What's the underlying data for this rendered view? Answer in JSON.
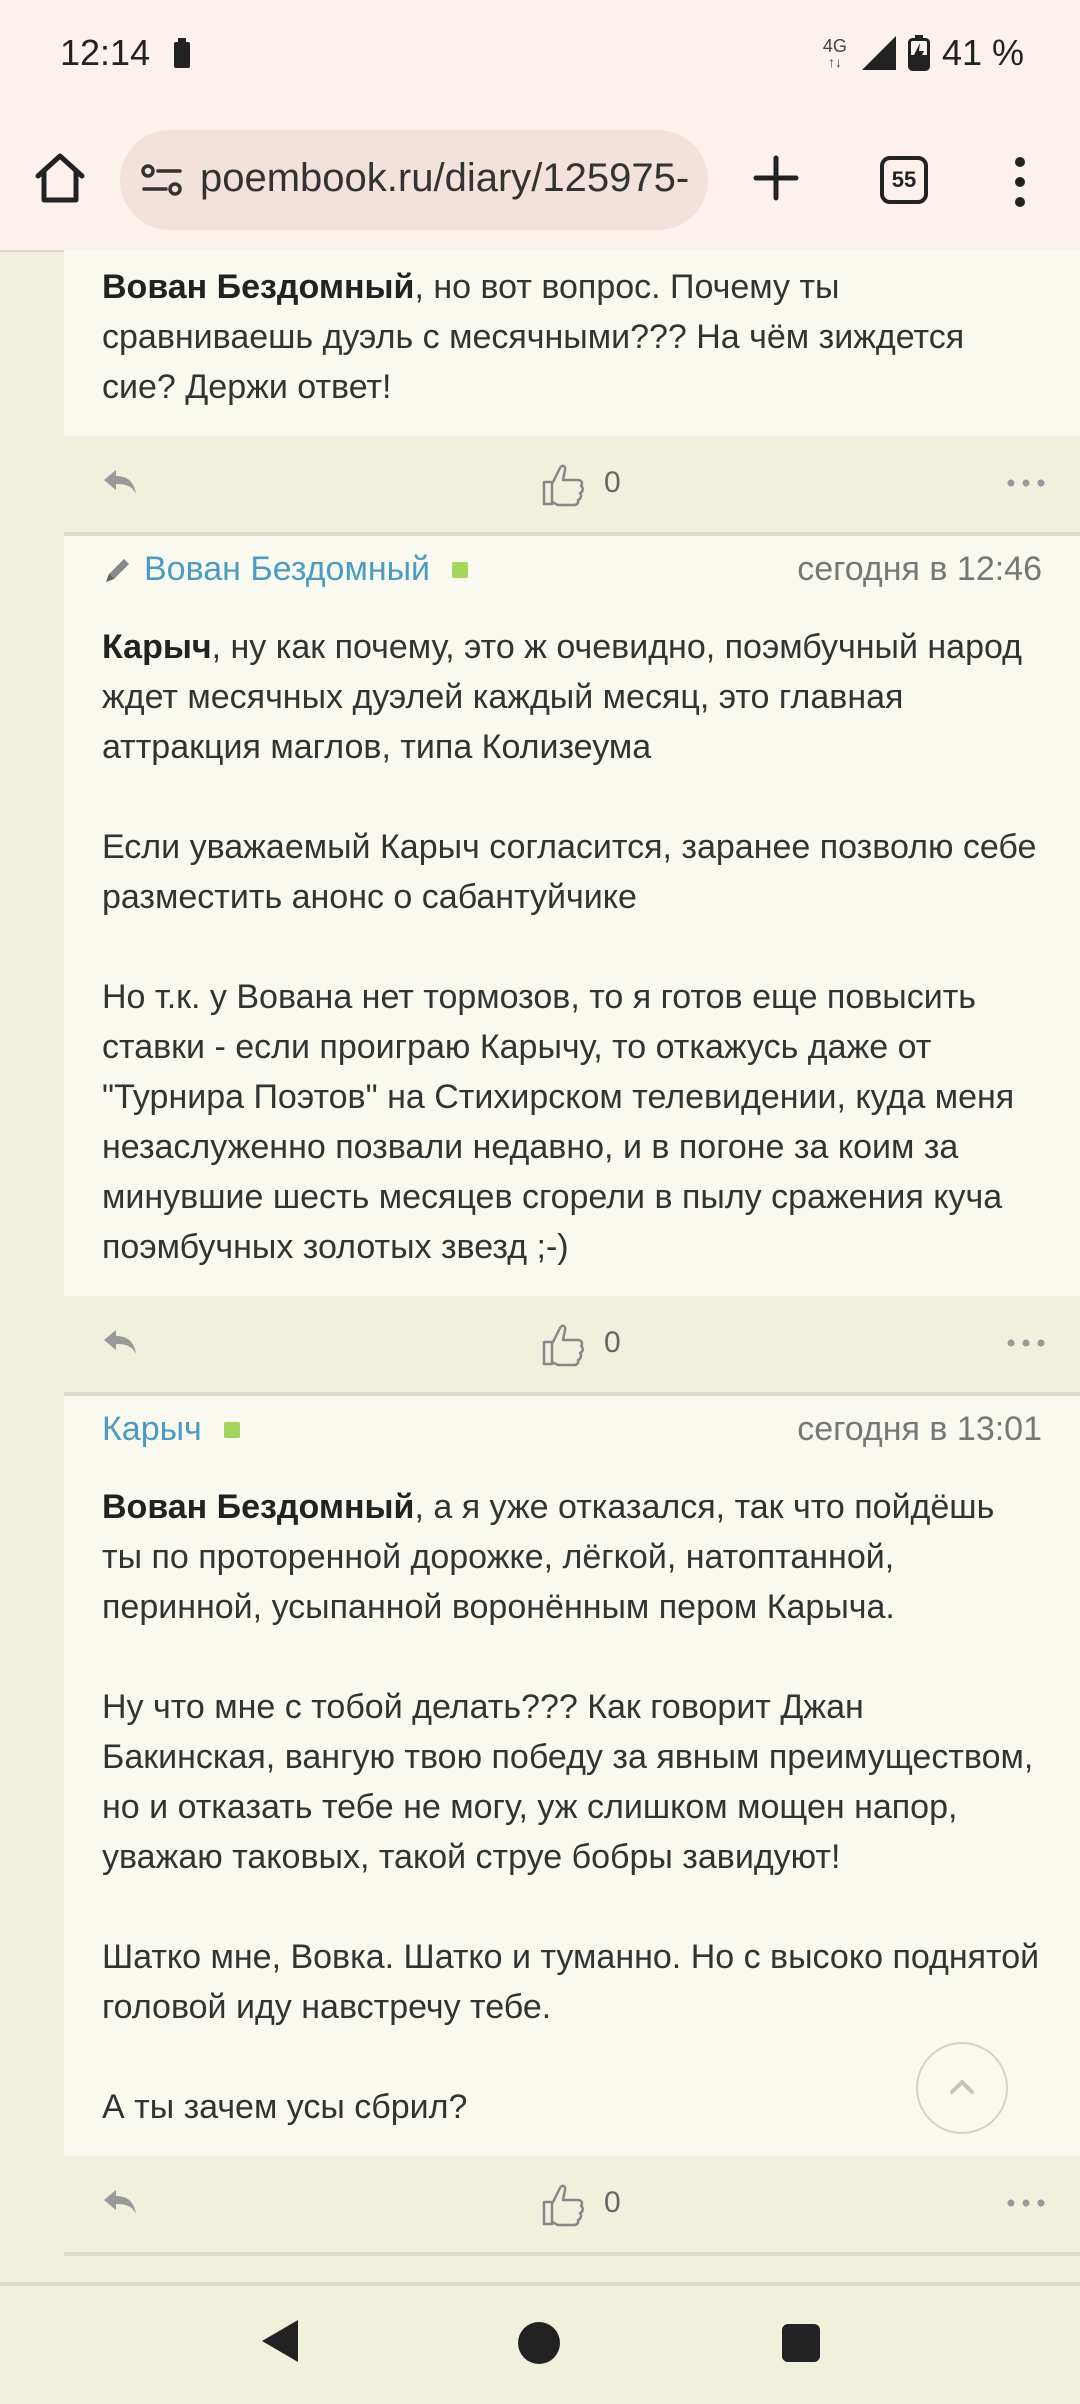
{
  "status": {
    "time": "12:14",
    "network_top": "4G",
    "network_bottom": "↑↓",
    "battery_percent": "41 %"
  },
  "browser": {
    "url": "poembook.ru/diary/125975-",
    "tab_count": "55"
  },
  "comments": [
    {
      "author": "",
      "time": "",
      "body": [
        [
          {
            "t": "Вован Бездомный",
            "b": true
          },
          {
            "t": ", но вот вопрос. Почему ты сравниваешь дуэль с месячными??? На чём зиждется сие? Держи ответ!"
          }
        ]
      ],
      "likes": "0"
    },
    {
      "author": "Вован Бездомный",
      "edited": true,
      "time": "сегодня в 12:46",
      "body": [
        [
          {
            "t": "Карыч",
            "b": true
          },
          {
            "t": ", ну как почему, это ж очевидно, поэмбучный народ ждет месячных дуэлей каждый месяц, это главная аттракция маглов, типа Колизеума"
          }
        ],
        [
          {
            "t": "Если уважаемый Карыч согласится, заранее позволю себе разместить анонс о сабантуйчике"
          }
        ],
        [
          {
            "t": "Но т.к. у Вована нет тормозов, то я готов еще повысить ставки - если проиграю Карычу, то откажусь даже от \"Турнира Поэтов\" на Стихирском телевидении, куда меня незаслуженно позвали недавно, и в погоне за коим за минувшие шесть месяцев сгорели в пылу сражения куча поэмбучных золотых звезд ;-)"
          }
        ]
      ],
      "likes": "0"
    },
    {
      "author": "Карыч",
      "edited": false,
      "time": "сегодня в 13:01",
      "body": [
        [
          {
            "t": "Вован Бездомный",
            "b": true
          },
          {
            "t": ", а я уже отказался, так что пойдёшь ты по проторенной дорожке, лёгкой, натоптанной, перинной, усыпанной воронённым пером Карыча."
          }
        ],
        [
          {
            "t": "Ну что мне с тобой делать??? Как говорит Джан Бакинская, вангую твою победу за явным преимуществом, но и отказать тебе не могу, уж слишком мощен напор, уважаю таковых, такой струе бобры завидуют!"
          }
        ],
        [
          {
            "t": "Шатко мне, Вовка. Шатко и туманно. Но с высоко поднятой головой иду навстречу тебе."
          }
        ],
        [
          {
            "t": "А ты зачем усы сбрил?"
          }
        ]
      ],
      "likes": "0"
    }
  ]
}
